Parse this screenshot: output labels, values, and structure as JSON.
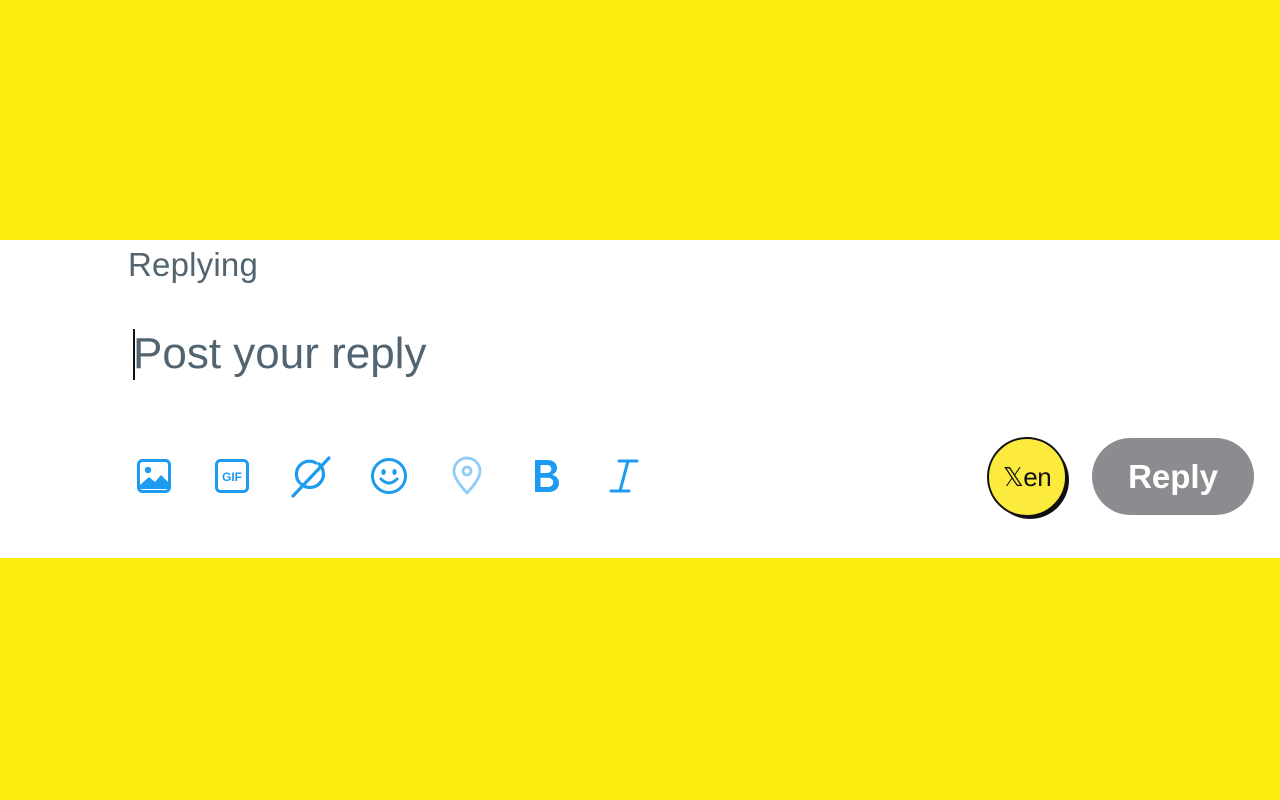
{
  "colors": {
    "page_background": "#FCEB0C",
    "panel_background": "#FFFFFF",
    "secondary_text": "#536471",
    "icon_blue": "#1D9BF0",
    "icon_blue_light": "#8ECDF8",
    "reply_button_disabled": "#8A8C8F",
    "xen_badge_yellow": "#FCEB3C"
  },
  "composer": {
    "replying_label": "Replying",
    "input": {
      "value": "",
      "placeholder": "Post your reply"
    },
    "toolbar": [
      {
        "icon": "image-icon"
      },
      {
        "icon": "gif-icon"
      },
      {
        "icon": "grok-icon"
      },
      {
        "icon": "emoji-icon"
      },
      {
        "icon": "location-icon"
      },
      {
        "icon": "bold-icon"
      },
      {
        "icon": "italic-icon"
      }
    ],
    "gif_text": "GIF",
    "xen_badge_label": "𝕏en",
    "reply_button_label": "Reply"
  }
}
